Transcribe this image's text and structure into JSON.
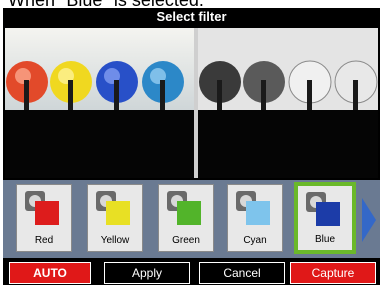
{
  "caption": "When \"Blue\" is selected.",
  "window": {
    "title": "Select filter"
  },
  "filters": [
    {
      "label": "Red",
      "color": "#dd1c1c",
      "selected": false
    },
    {
      "label": "Yellow",
      "color": "#e8e024",
      "selected": false
    },
    {
      "label": "Green",
      "color": "#52b42a",
      "selected": false
    },
    {
      "label": "Cyan",
      "color": "#7ec4ec",
      "selected": false
    },
    {
      "label": "Blue",
      "color": "#1c3ca8",
      "selected": true
    }
  ],
  "buttons": {
    "auto": "AUTO",
    "apply": "Apply",
    "cancel": "Cancel",
    "capture": "Capture"
  },
  "colors": {
    "accent_red": "#e01818",
    "selected_border": "#6ab82a",
    "strip_bg": "#6a7a92",
    "scroll_arrow": "#3468c8"
  },
  "icons": {
    "next": "chevron-right-icon"
  }
}
